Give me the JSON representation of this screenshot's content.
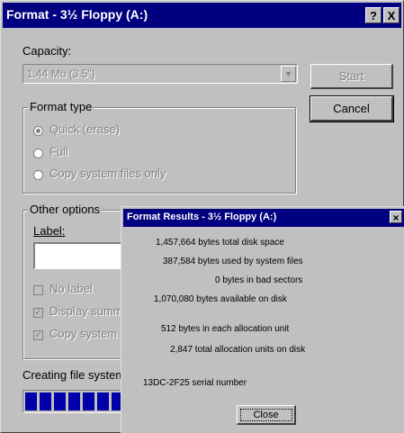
{
  "window": {
    "title": "Format - 3½ Floppy (A:)",
    "help_btn": "?",
    "close_btn": "X"
  },
  "capacity": {
    "label": "Capacity:",
    "value": "1.44 Mb (3.5\")"
  },
  "buttons": {
    "start": "Start",
    "cancel": "Cancel"
  },
  "format_type": {
    "title": "Format type",
    "options": [
      "Quick (erase)",
      "Full",
      "Copy system files only"
    ]
  },
  "other_options": {
    "title": "Other options",
    "label_caption": "Label:",
    "checkboxes": [
      "No label",
      "Display summ",
      "Copy system"
    ]
  },
  "status": {
    "text": "Creating file system"
  },
  "progress": {
    "filled_blocks": 10,
    "value": 1.0
  },
  "results": {
    "title": "Format Results - 3½ Floppy (A:)",
    "close_x": "×",
    "lines": [
      "1,457,664 bytes total disk space",
      "387,584 bytes used by system files",
      "0 bytes in bad sectors",
      "1,070,080 bytes available on disk",
      "512 bytes in each allocation unit",
      "2,847 total allocation units on disk",
      "13DC-2F25 serial number"
    ],
    "close_button": "Close"
  }
}
